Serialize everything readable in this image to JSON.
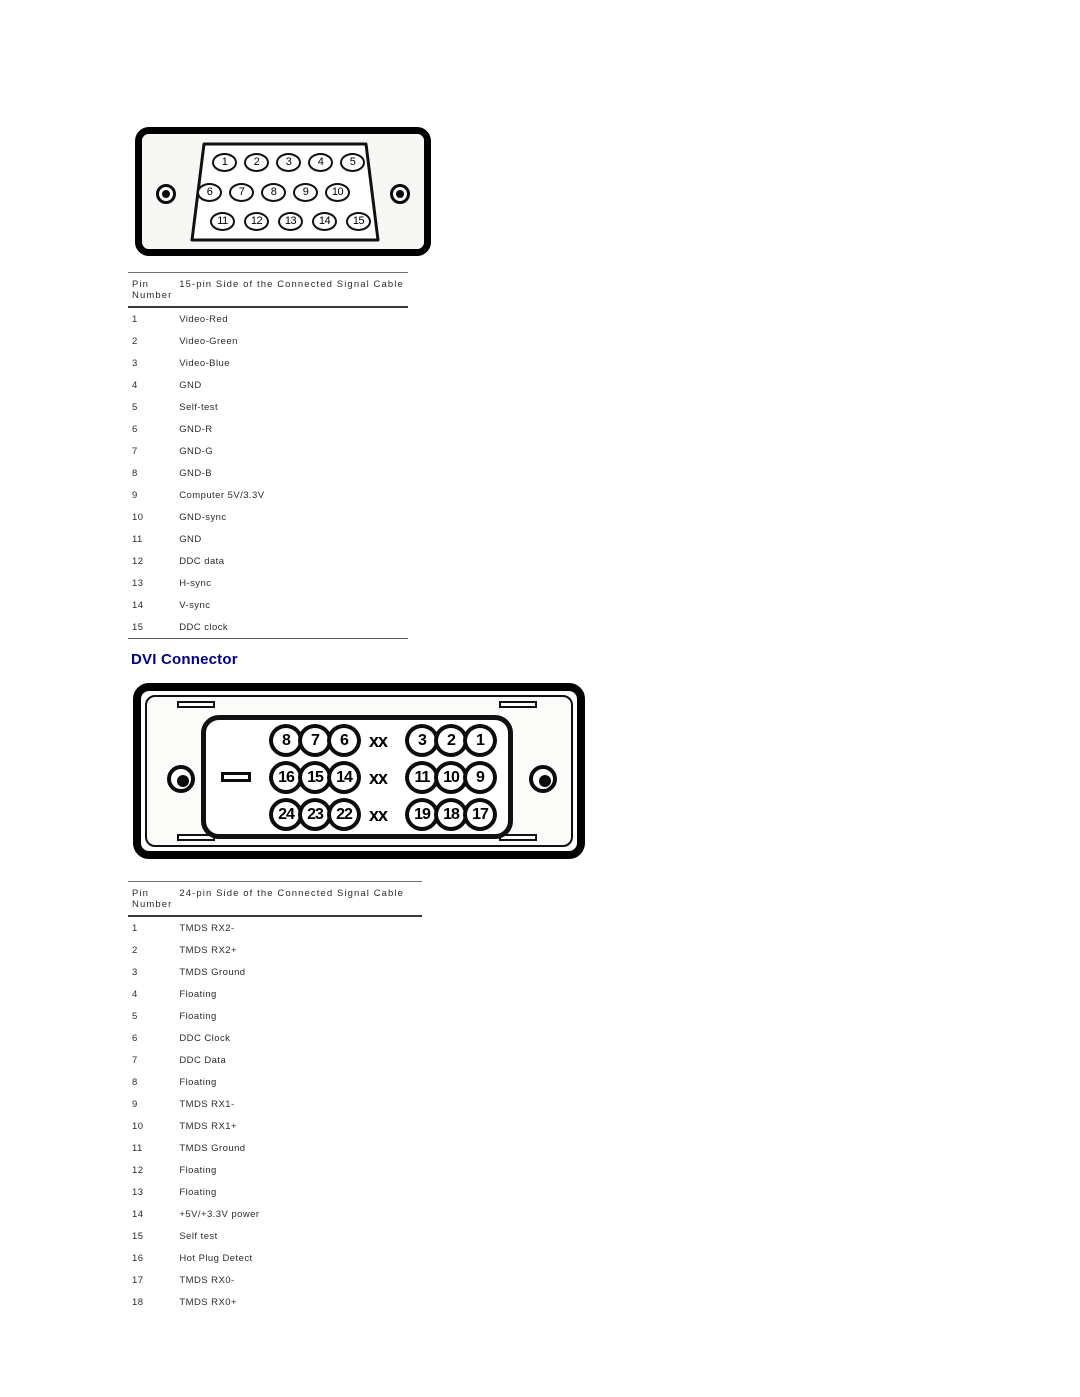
{
  "vga": {
    "diagram": {
      "name": "15-pin VGA D-sub connector",
      "rows": [
        [
          "1",
          "2",
          "3",
          "4",
          "5"
        ],
        [
          "6",
          "7",
          "8",
          "9",
          "10"
        ],
        [
          "11",
          "12",
          "13",
          "14",
          "15"
        ]
      ]
    },
    "table": {
      "header_pin": "Pin Number",
      "header_pin_line1": "Pin",
      "header_pin_line2": "Number",
      "header_signal": "15-pin Side of the Connected Signal Cable",
      "rows": [
        {
          "pin": "1",
          "signal": "Video-Red"
        },
        {
          "pin": "2",
          "signal": "Video-Green"
        },
        {
          "pin": "3",
          "signal": "Video-Blue"
        },
        {
          "pin": "4",
          "signal": "GND"
        },
        {
          "pin": "5",
          "signal": "Self-test"
        },
        {
          "pin": "6",
          "signal": "GND-R"
        },
        {
          "pin": "7",
          "signal": "GND-G"
        },
        {
          "pin": "8",
          "signal": "GND-B"
        },
        {
          "pin": "9",
          "signal": "Computer 5V/3.3V"
        },
        {
          "pin": "10",
          "signal": "GND-sync"
        },
        {
          "pin": "11",
          "signal": "GND"
        },
        {
          "pin": "12",
          "signal": "DDC data"
        },
        {
          "pin": "13",
          "signal": "H-sync"
        },
        {
          "pin": "14",
          "signal": "V-sync"
        },
        {
          "pin": "15",
          "signal": "DDC clock"
        }
      ]
    }
  },
  "dvi": {
    "heading": "DVI Connector",
    "diagram": {
      "name": "24-pin DVI-D connector",
      "rows": [
        [
          "8",
          "7",
          "6",
          "xx",
          "3",
          "2",
          "1"
        ],
        [
          "16",
          "15",
          "14",
          "xx",
          "11",
          "10",
          "9"
        ],
        [
          "24",
          "23",
          "22",
          "xx",
          "19",
          "18",
          "17"
        ]
      ],
      "blank_marker": "xx"
    },
    "table": {
      "header_pin": "Pin Number",
      "header_pin_line1": "Pin",
      "header_pin_line2": "Number",
      "header_signal": "24-pin Side of the Connected Signal Cable",
      "rows": [
        {
          "pin": "1",
          "signal": "TMDS RX2-"
        },
        {
          "pin": "2",
          "signal": "TMDS RX2+"
        },
        {
          "pin": "3",
          "signal": "TMDS Ground"
        },
        {
          "pin": "4",
          "signal": "Floating"
        },
        {
          "pin": "5",
          "signal": "Floating"
        },
        {
          "pin": "6",
          "signal": "DDC Clock"
        },
        {
          "pin": "7",
          "signal": "DDC Data"
        },
        {
          "pin": "8",
          "signal": "Floating"
        },
        {
          "pin": "9",
          "signal": "TMDS RX1-"
        },
        {
          "pin": "10",
          "signal": "TMDS RX1+"
        },
        {
          "pin": "11",
          "signal": "TMDS Ground"
        },
        {
          "pin": "12",
          "signal": "Floating"
        },
        {
          "pin": "13",
          "signal": "Floating"
        },
        {
          "pin": "14",
          "signal": "+5V/+3.3V power"
        },
        {
          "pin": "15",
          "signal": "Self test"
        },
        {
          "pin": "16",
          "signal": "Hot Plug Detect"
        },
        {
          "pin": "17",
          "signal": "TMDS RX0-"
        },
        {
          "pin": "18",
          "signal": "TMDS RX0+"
        }
      ]
    }
  },
  "colors": {
    "heading": "#000080",
    "text": "#231f20",
    "background": "#ffffff"
  }
}
